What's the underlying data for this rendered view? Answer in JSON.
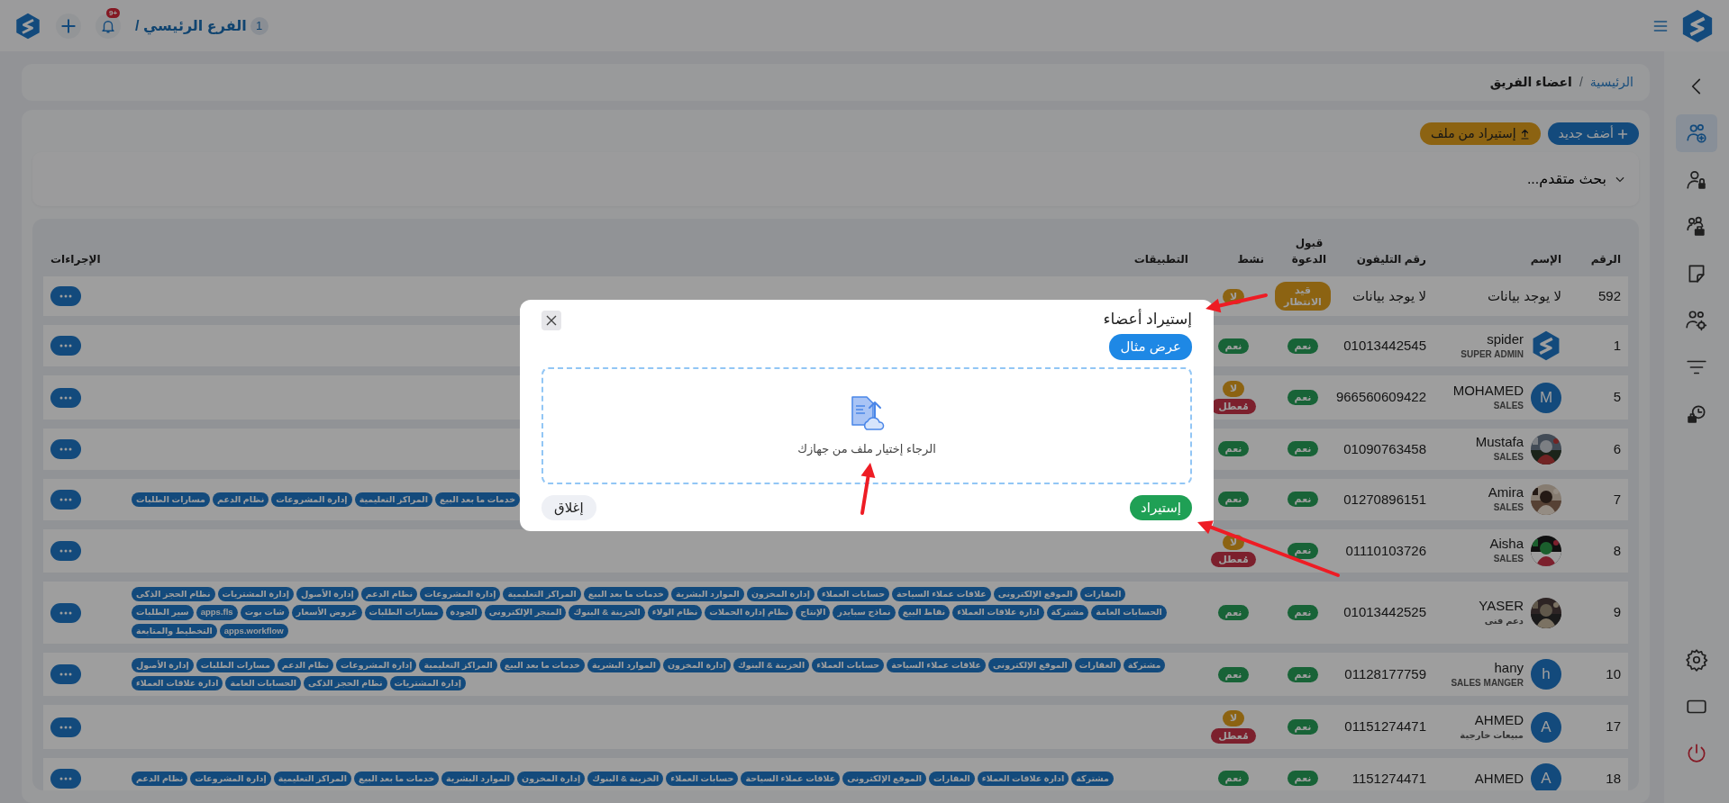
{
  "topbar": {
    "branch_count": "1",
    "branch": "الفرع الرئيسي /",
    "notification_badge": "+9"
  },
  "sidebar": {
    "items": [
      {
        "kind": "back",
        "selected": false
      },
      {
        "kind": "team-add",
        "selected": true
      },
      {
        "kind": "user-lock",
        "selected": false
      },
      {
        "kind": "team-work",
        "selected": false
      },
      {
        "kind": "note",
        "selected": false
      },
      {
        "kind": "team-gear",
        "selected": false
      },
      {
        "kind": "filter",
        "selected": false
      },
      {
        "kind": "work-clock",
        "selected": false
      }
    ],
    "bottom": [
      {
        "kind": "settings"
      },
      {
        "kind": "window"
      },
      {
        "kind": "power"
      }
    ]
  },
  "breadcrumb": {
    "separator": "/",
    "items": [
      {
        "label": "الرئيسية",
        "selected": false
      },
      {
        "label": "اعضاء الفريق",
        "selected": true
      }
    ]
  },
  "actions": [
    {
      "label": "أضف جديد",
      "kind": "add"
    },
    {
      "label": "إستيراد من ملف",
      "kind": "import"
    }
  ],
  "search": {
    "label": "بحث متقدم...",
    "expanded": false
  },
  "table": {
    "columns": [
      "الرقم",
      "الإسم",
      "رقم التليفون",
      "قبول الدعوة",
      "نشط",
      "التطبيقات",
      "الإجراءات"
    ],
    "rows": [
      {
        "number": "592",
        "name": "لا يوجد بيانات",
        "phone": "لا يوجد بيانات",
        "invite": {
          "text": "قيد الانتظار",
          "kind": "pending"
        },
        "active": [
          {
            "text": "لا",
            "kind": "warning"
          }
        ],
        "apps": []
      },
      {
        "number": "1",
        "name": "spider",
        "role": "SUPER ADMIN",
        "avatar": {
          "kind": "logo"
        },
        "phone": "01013442545",
        "invite": {
          "text": "نعم",
          "kind": "success"
        },
        "active": [
          {
            "text": "نعم",
            "kind": "success"
          }
        ],
        "apps": []
      },
      {
        "number": "5",
        "name": "MOHAMED",
        "role": "SALES",
        "avatar": {
          "kind": "letter",
          "letter": "M"
        },
        "phone": "966560609422",
        "invite": {
          "text": "نعم",
          "kind": "success"
        },
        "active": [
          {
            "text": "لا",
            "kind": "warning"
          },
          {
            "text": "مُعطل",
            "kind": "danger"
          }
        ],
        "apps": []
      },
      {
        "number": "6",
        "name": "Mustafa",
        "role": "SALES",
        "avatar": {
          "kind": "picture"
        },
        "phone": "01090763458",
        "invite": {
          "text": "نعم",
          "kind": "success"
        },
        "active": [
          {
            "text": "نعم",
            "kind": "success"
          }
        ],
        "apps": []
      },
      {
        "number": "7",
        "name": "Amira",
        "role": "SALES",
        "avatar": {
          "kind": "picture"
        },
        "phone": "01270896151",
        "invite": {
          "text": "نعم",
          "kind": "success"
        },
        "active": [
          {
            "text": "نعم",
            "kind": "success"
          }
        ],
        "apps": [
          "خدمات ما بعد البيع",
          "المراكز التعليمية",
          "إدارة المشروعات",
          "نظام الدعم",
          "مسارات الطلبات"
        ]
      },
      {
        "number": "8",
        "name": "Aisha",
        "role": "SALES",
        "avatar": {
          "kind": "picture"
        },
        "phone": "01110103726",
        "invite": {
          "text": "نعم",
          "kind": "success"
        },
        "active": [
          {
            "text": "لا",
            "kind": "warning"
          },
          {
            "text": "مُعطل",
            "kind": "danger"
          }
        ],
        "apps": []
      },
      {
        "number": "9",
        "name": "YASER",
        "role": "دعم فنى",
        "avatar": {
          "kind": "picture"
        },
        "phone": "01013442525",
        "invite": {
          "text": "نعم",
          "kind": "success"
        },
        "active": [
          {
            "text": "نعم",
            "kind": "success"
          }
        ],
        "apps": [
          "العقارات",
          "الموقع الإلكترونى",
          "علاقات عملاء السياحة",
          "حسابات العملاء",
          "إدارة المخزون",
          "الموارد البشرية",
          "خدمات ما بعد البيع",
          "المراكز التعليمية",
          "إدارة المشروعات",
          "نظام الدعم",
          "إدارة الأصول",
          "إدارة المشتريات",
          "نظام الحجز الذكى",
          "الحسابات العامة",
          "مشتركة",
          "ادارة علاقات العملاء",
          "نقاط البيع",
          "نماذج سبايدر",
          "الإنتاج",
          "نظام إدارة الحملات",
          "نظام الولاء",
          "الخزينة & البنوك",
          "المتجر الإلكترونى",
          "الجودة",
          "مسارات الطلبات",
          "عروض الأسعار",
          "شات بوت",
          "apps.fls",
          "سير الطلبات",
          "apps.workflow",
          "التخطيط والمتابعة"
        ]
      },
      {
        "number": "10",
        "name": "hany",
        "role": "SALES MANGER",
        "avatar": {
          "kind": "letter",
          "letter": "h"
        },
        "phone": "01128177759",
        "invite": {
          "text": "نعم",
          "kind": "success"
        },
        "active": [
          {
            "text": "نعم",
            "kind": "success"
          }
        ],
        "apps": [
          "مشتركة",
          "العقارات",
          "الموقع الإلكترونى",
          "علاقات عملاء السياحة",
          "حسابات العملاء",
          "الخزينة & البنوك",
          "إدارة المخزون",
          "الموارد البشرية",
          "خدمات ما بعد البيع",
          "المراكز التعليمية",
          "إدارة المشروعات",
          "نظام الدعم",
          "مسارات الطلبات",
          "إدارة الأصول",
          "إدارة المشتريات",
          "نظام الحجز الذكى",
          "الحسابات العامة",
          "ادارة علاقات العملاء"
        ]
      },
      {
        "number": "17",
        "name": "AHMED",
        "role": "مبيعات خارجية",
        "avatar": {
          "kind": "letter",
          "letter": "A"
        },
        "phone": "01151274471",
        "invite": {
          "text": "نعم",
          "kind": "success"
        },
        "active": [
          {
            "text": "لا",
            "kind": "warning"
          },
          {
            "text": "مُعطل",
            "kind": "danger"
          }
        ],
        "apps": []
      },
      {
        "number": "18",
        "name": "AHMED",
        "avatar": {
          "kind": "letter",
          "letter": "A"
        },
        "phone": "1151274471",
        "invite": {
          "text": "نعم",
          "kind": "success"
        },
        "active": [
          {
            "text": "نعم",
            "kind": "success"
          }
        ],
        "apps": [
          "مشتركة",
          "ادارة علاقات العملاء",
          "العقارات",
          "الموقع الإلكترونى",
          "علاقات عملاء السياحة",
          "حسابات العملاء",
          "الخزينة & البنوك",
          "إدارة المخزون",
          "الموارد البشرية",
          "خدمات ما بعد البيع",
          "المراكز التعليمية",
          "إدارة المشروعات",
          "نظام الدعم"
        ]
      }
    ]
  },
  "modal": {
    "title": "إستيراد أعضاء",
    "example_button": "عرض مثال",
    "dropzone_text": "الرجاء إختيار ملف من جهازك",
    "import_button": "إستيراد",
    "close_button": "إغلاق"
  }
}
